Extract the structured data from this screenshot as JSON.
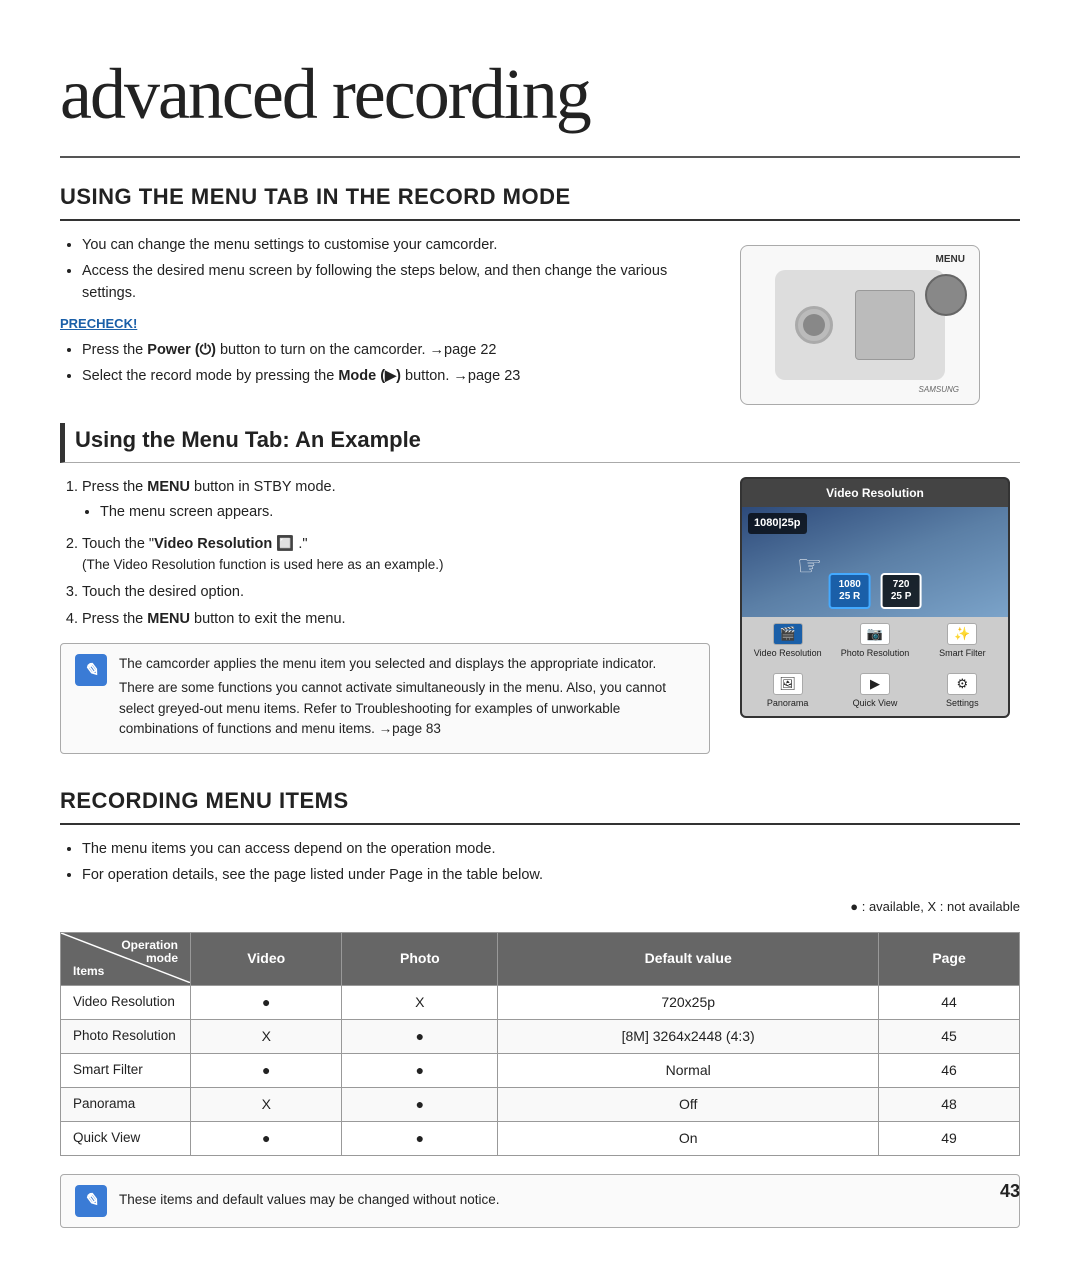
{
  "page": {
    "title": "advanced recording",
    "number": "43"
  },
  "section1": {
    "heading": "USING THE MENU TAB IN THE RECORD MODE",
    "bullets": [
      "You can change the menu settings to customise your camcorder.",
      "Access the desired menu screen by following the steps below, and then change the various settings."
    ],
    "precheck_label": "PRECHECK!",
    "precheck_bullets": [
      "Press the Power (⏻) button to turn on the camcorder. →page 22",
      "Select the record mode by pressing the Mode (▶) button. →page 23"
    ],
    "camera_menu_label": "MENU",
    "camera_brand": "SAMSUNG"
  },
  "section2": {
    "heading": "Using the Menu Tab: An Example",
    "steps": [
      {
        "text": "Press the MENU button in STBY mode.",
        "sub": [
          "The menu screen appears."
        ]
      },
      {
        "text": "Touch the \"Video Resolution 🔲 .\"",
        "sub": [
          "(The Video Resolution function is used here as an example.)"
        ]
      },
      {
        "text": "Touch the desired option.",
        "sub": []
      },
      {
        "text": "Press the MENU button to exit the menu.",
        "sub": []
      }
    ],
    "note_bullets": [
      "The camcorder applies the menu item you selected and displays the appropriate indicator.",
      "There are some functions you cannot activate simultaneously in the menu. Also, you cannot select greyed-out menu items. Refer to Troubleshooting for examples of unworkable combinations of functions and menu items. →page 83"
    ],
    "video_ui": {
      "header": "Video Resolution",
      "badge": "1080|25p",
      "options": [
        "1080\n25 R",
        "720\n25 P"
      ],
      "active_index": 0,
      "icon_rows": [
        {
          "icon": "🎬",
          "label": "Video\nResolution",
          "selected": true
        },
        {
          "icon": "📷",
          "label": "Photo\nResolution",
          "selected": false
        },
        {
          "icon": "✨",
          "label": "Smart\nFilter",
          "selected": false
        },
        {
          "icon": "🖼",
          "label": "Panorama",
          "selected": false
        },
        {
          "icon": "▶",
          "label": "Quick\nView",
          "selected": false
        },
        {
          "icon": "⚙",
          "label": "Settings",
          "selected": false
        }
      ]
    }
  },
  "section3": {
    "heading": "RECORDING MENU ITEMS",
    "bullets": [
      "The menu items you can access depend on the operation mode.",
      "For operation details, see the page listed under Page in the table below."
    ],
    "availability_note": "● : available, X : not available",
    "table": {
      "col_headers": [
        "Video",
        "Photo",
        "Default value",
        "Page"
      ],
      "row_header_top": "Operation\nmode",
      "row_header_bottom": "Items",
      "rows": [
        {
          "item": "Video Resolution",
          "video": "●",
          "photo": "X",
          "default": "720x25p",
          "page": "44"
        },
        {
          "item": "Photo Resolution",
          "video": "X",
          "photo": "●",
          "default": "[8M] 3264x2448 (4:3)",
          "page": "45"
        },
        {
          "item": "Smart Filter",
          "video": "●",
          "photo": "●",
          "default": "Normal",
          "page": "46"
        },
        {
          "item": "Panorama",
          "video": "X",
          "photo": "●",
          "default": "Off",
          "page": "48"
        },
        {
          "item": "Quick View",
          "video": "●",
          "photo": "●",
          "default": "On",
          "page": "49"
        }
      ]
    }
  },
  "bottom_note": {
    "text": "These items and default values may be changed without notice."
  },
  "icons": {
    "note_icon": "🖊"
  }
}
